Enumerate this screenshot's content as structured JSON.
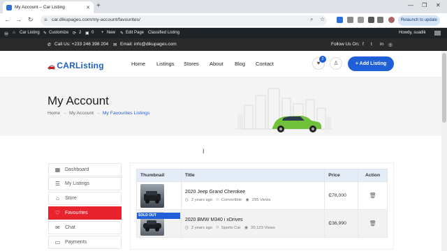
{
  "browser": {
    "tab_title": "My Account – Car Listing",
    "url": "car.dikupages.com/my-account/favourites/",
    "relaunch_label": "Relaunch to update"
  },
  "wp_admin_bar": {
    "site_name": "Car Listing",
    "customize": "Customize",
    "updates_count": "2",
    "comments_count": "0",
    "new_label": "New",
    "edit_page": "Edit Page",
    "classified": "Classified Listing",
    "howdy": "Howdy, suadik"
  },
  "topbar": {
    "call": "Call Us: +233 246 398 204",
    "email": "Email: info@dikupages.com",
    "follow": "Follow Us On:"
  },
  "header": {
    "logo_text": "CARListing",
    "nav": [
      "Home",
      "Listings",
      "Stores",
      "About",
      "Blog",
      "Contact"
    ],
    "fav_count": "2",
    "add_listing": "+ Add Listing"
  },
  "hero": {
    "title": "My Account",
    "breadcrumb": [
      "Home",
      "My Account",
      "My Favourites Listings"
    ]
  },
  "sidebar": {
    "items": [
      {
        "label": "Dashboard",
        "icon": "dashboard-icon"
      },
      {
        "label": "My Listings",
        "icon": "list-icon"
      },
      {
        "label": "Store",
        "icon": "store-icon"
      },
      {
        "label": "Favourites",
        "icon": "heart-icon"
      },
      {
        "label": "Chat",
        "icon": "chat-icon"
      },
      {
        "label": "Payments",
        "icon": "payments-icon"
      }
    ]
  },
  "table": {
    "headers": [
      "Thumbnail",
      "Title",
      "Price",
      "Action"
    ],
    "rows": [
      {
        "title": "2020 Jeep Grand Cherokee",
        "age": "2 years ago",
        "category": "Convertible",
        "views": "295 Views",
        "price": "₵78,000"
      },
      {
        "title": "2020 BMW M340 i xDrives",
        "age": "2 years ago",
        "category": "Sports Car",
        "views": "20,123 Views",
        "price": "₵36,990",
        "badge": "SOLD OUT"
      }
    ]
  },
  "colors": {
    "accent": "#1f5fd8",
    "active_red": "#e8232d",
    "dark_bar": "#2a2a2a",
    "car_green": "#6fc23a"
  }
}
